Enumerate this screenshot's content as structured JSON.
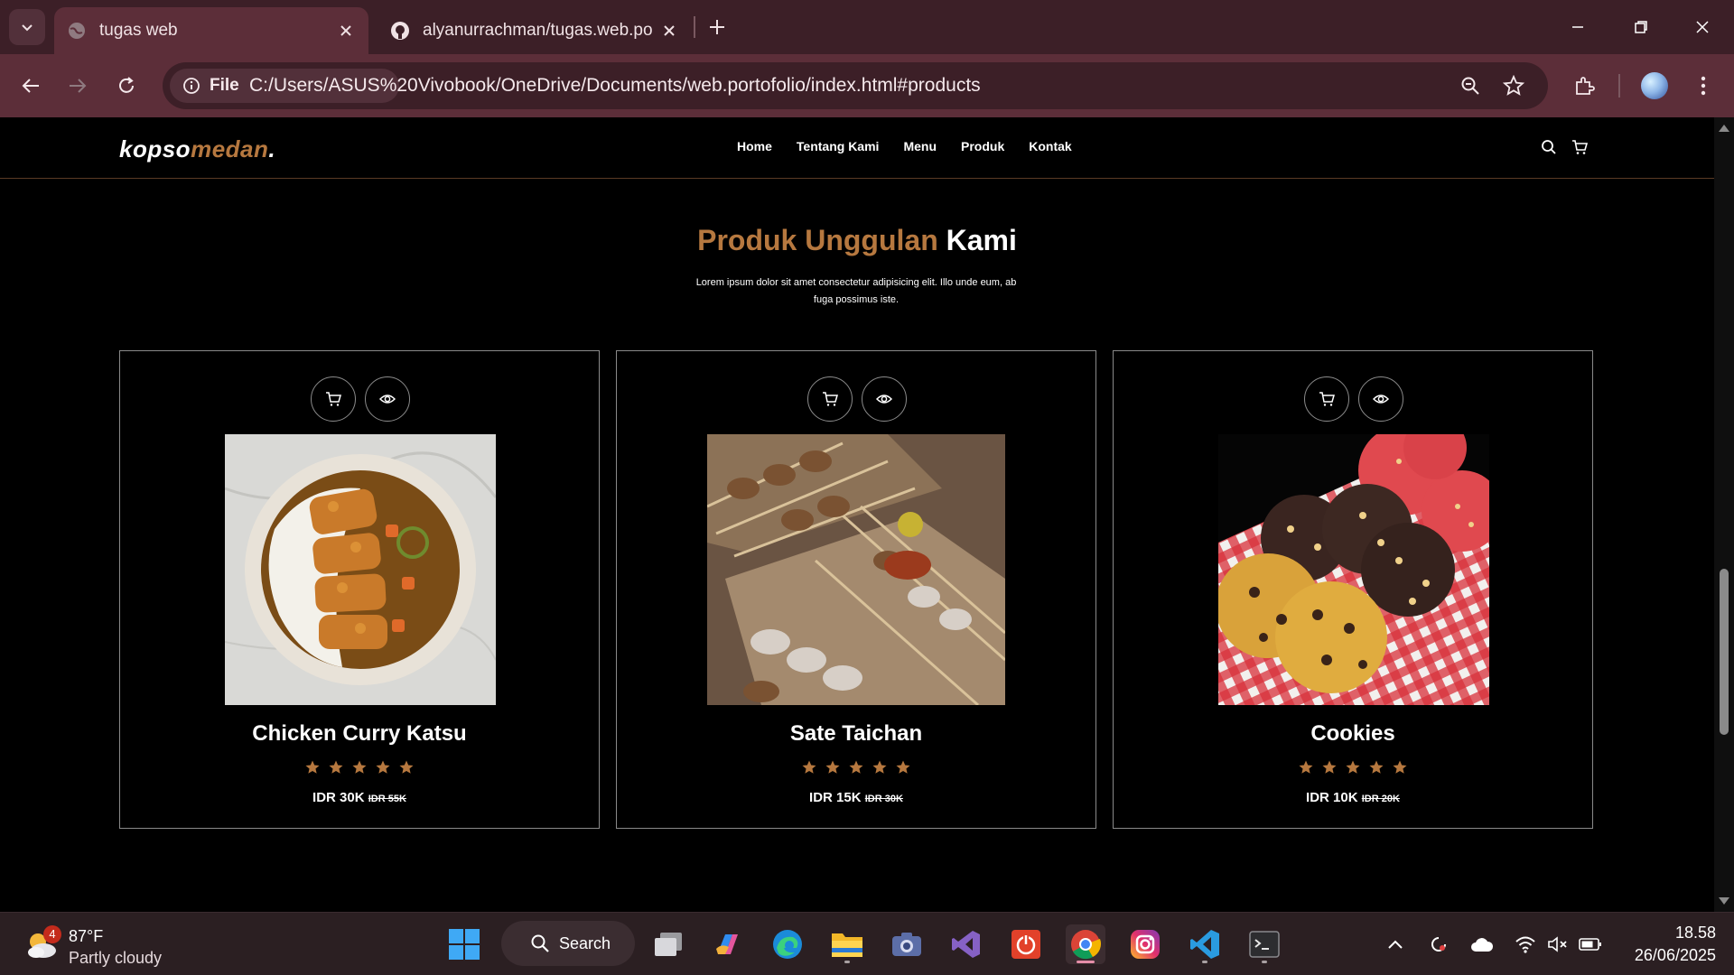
{
  "browser": {
    "tabs": [
      {
        "title": "tugas web",
        "active": true
      },
      {
        "title": "alyanurrachman/tugas.web.port",
        "active": false
      }
    ],
    "info_chip_label": "File",
    "url": "C:/Users/ASUS%20Vivobook/OneDrive/Documents/web.portofolio/index.html#products"
  },
  "site": {
    "logo": {
      "part1": "kopso",
      "part2": "medan",
      "part3": "."
    },
    "nav": [
      "Home",
      "Tentang Kami",
      "Menu",
      "Produk",
      "Kontak"
    ],
    "section": {
      "title_accent": "Produk Unggulan",
      "title_rest": "Kami",
      "description": "Lorem ipsum dolor sit amet consectetur adipisicing elit. Illo unde eum, ab fuga possimus iste."
    },
    "products": [
      {
        "name": "Chicken Curry Katsu",
        "price": "IDR 30K",
        "old_price": "IDR 55K",
        "rating": 5
      },
      {
        "name": "Sate Taichan",
        "price": "IDR 15K",
        "old_price": "IDR 30K",
        "rating": 5
      },
      {
        "name": "Cookies",
        "price": "IDR 10K",
        "old_price": "IDR 20K",
        "rating": 5
      }
    ]
  },
  "colors": {
    "accent": "#b6783f",
    "chrome_dark": "#3c1f27",
    "chrome_mid": "#5c2e39"
  },
  "taskbar": {
    "weather": {
      "temp": "87°F",
      "condition": "Partly cloudy",
      "badge": "4"
    },
    "search_label": "Search",
    "time": "18.58",
    "date": "26/06/2025"
  }
}
